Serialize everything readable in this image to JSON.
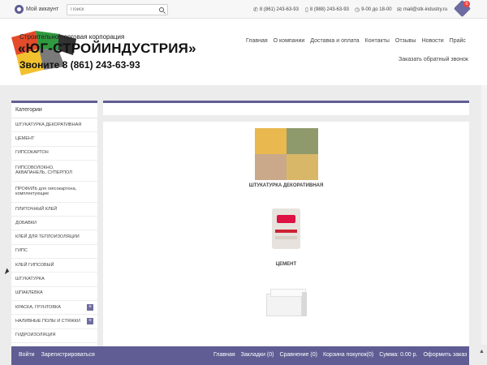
{
  "topbar": {
    "account_label": "Мой аккаунт",
    "search_placeholder": "Поиск",
    "phone1": "8 (861) 243-63-93",
    "phone2": "8 (988) 243-63-93",
    "hours": "9-00 до 18-00",
    "email": "mail@stk-industry.ru",
    "cart_count": "0"
  },
  "header": {
    "tagline": "Строительно-торговая корпорация",
    "brand": "«ЮГ-СТРОЙИНДУСТРИЯ»",
    "phone_line": "Звоните 8 (861) 243-63-93",
    "nav": [
      "Главная",
      "О компании",
      "Доставка и оплата",
      "Контакты",
      "Отзывы",
      "Новости",
      "Прайс"
    ],
    "callback": "Заказать обратный звонок"
  },
  "sidebar": {
    "title": "Категории",
    "items": [
      {
        "label": "ШТУКАТУРКА ДЕКОРАТИВНАЯ"
      },
      {
        "label": "ЦЕМЕНТ"
      },
      {
        "label": "ГИПСОКАРТОН"
      },
      {
        "label": "ГИПСОВОЛОКНО, АКВАПАНЕЛЬ, СУПЕРПОЛ"
      },
      {
        "label": "ПРОФИЛЬ для гипсокартона, комплектующие"
      },
      {
        "label": "ПЛИТОЧНЫЙ КЛЕЙ"
      },
      {
        "label": "ДОБАВКИ"
      },
      {
        "label": "КЛЕЙ ДЛЯ ТЕПЛОИЗОЛЯЦИИ"
      },
      {
        "label": "ГИПС"
      },
      {
        "label": "КЛЕЙ ГИПСОВЫЙ"
      },
      {
        "label": "ШТУКАТУРКА"
      },
      {
        "label": "ШПАКЛЕВКА"
      },
      {
        "label": "КРАСКА, ГРУНТОВКА",
        "expand": "+"
      },
      {
        "label": "НАЛИВНЫЕ ПОЛЫ И СТЯЖКИ",
        "expand": "+"
      },
      {
        "label": "ГИДРОИЗОЛЯЦИЯ"
      }
    ]
  },
  "products": [
    {
      "label": "ШТУКАТУРКА ДЕКОРАТИВНАЯ"
    },
    {
      "label": "ЦЕМЕНТ"
    }
  ],
  "footer": {
    "login": "Войти",
    "register": "Зарегистрироваться",
    "home": "Главная",
    "bookmarks": "Закладки (0)",
    "compare": "Сравнение (0)",
    "cart": "Корзина покупок(0)",
    "sum": "Сумма: 0.00 р.",
    "checkout": "Оформить заказ"
  },
  "colors": {
    "accent": "#5f5d93",
    "badge": "#e44444"
  }
}
